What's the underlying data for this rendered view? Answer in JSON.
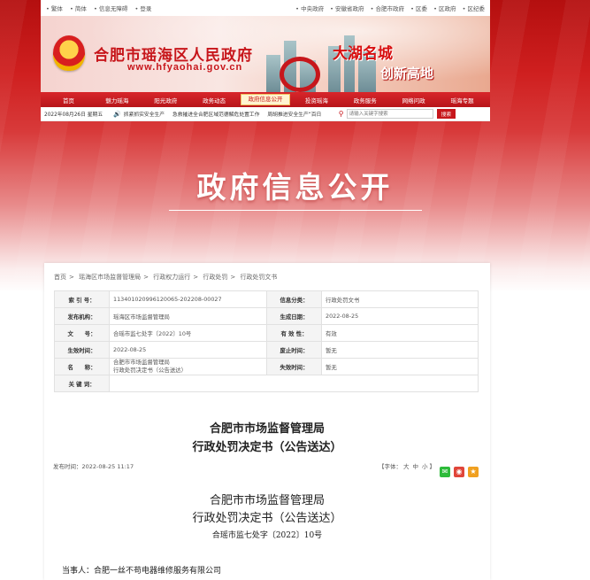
{
  "topbar": {
    "left": [
      "• 繁体",
      "• 简体",
      "• 信息无障碍",
      "• 登录"
    ],
    "right": [
      "• 中央政府",
      "• 安徽省政府",
      "• 合肥市政府",
      "• 区委",
      "• 区政府",
      "• 区纪委"
    ]
  },
  "banner": {
    "title": "合肥市瑶海区人民政府",
    "url": "www.hfyaohai.gov.cn",
    "slogan1": "大湖名城",
    "slogan2": "创新高地"
  },
  "nav": {
    "items": [
      "首页",
      "魅力瑶海",
      "阳光政府",
      "政务动态",
      "政府信息公开",
      "投资瑶海",
      "政务服务",
      "网络问政",
      "瑶海专题"
    ],
    "active_index": 4
  },
  "subbar": {
    "date": "2022年08月26日 星期五",
    "news": [
      "抓紧抓实安全生产",
      "急救摧进全合肥区域范德解危处置工作",
      "周胡推进安全生产“百日"
    ],
    "search_placeholder": "请输入关键字搜索",
    "search_button": "搜索"
  },
  "hero": {
    "title": "政府信息公开"
  },
  "breadcrumb": [
    "首页",
    "瑶海区市场监督管理局",
    "行政权力运行",
    "行政处罚",
    "行政处罚文书"
  ],
  "meta": {
    "index_label": "索 引 号：",
    "index_value": "113401020996120065-202208-00027",
    "category_label": "信息分类：",
    "category_value": "行政处罚文书",
    "publisher_label": "发布机构：",
    "publisher_value": "瑶海区市场监督管理局",
    "gen_date_label": "生成日期：",
    "gen_date_value": "2022-08-25",
    "docno_label": "文　　号：",
    "docno_value": "合瑶市监七处字〔2022〕10号",
    "validity_label": "有 效 性：",
    "validity_value": "有效",
    "effective_label": "生效时间：",
    "effective_value": "2022-08-25",
    "abolish_label": "废止时间：",
    "abolish_value": "暂无",
    "name_label": "名　　称：",
    "name_line1": "合肥市市场监督管理局",
    "name_line2": "行政处罚决定书（公告送达）",
    "expire_label": "失效时间：",
    "expire_value": "暂无",
    "keywords_label": "关 键 词：",
    "keywords_value": ""
  },
  "doc": {
    "title_line1": "合肥市市场监督管理局",
    "title_line2": "行政处罚决定书（公告送达）",
    "publish_time": "发布时间：2022-08-25 11:17",
    "font_label_open": "【字体：",
    "font_large": "大",
    "font_medium": "中",
    "font_small": "小",
    "font_label_close": "】",
    "body_line1": "合肥市市场监督管理局",
    "body_line2": "行政处罚决定书（公告送达）",
    "body_docno": "合瑶市监七处字〔2022〕10号",
    "party": "当事人：合肥一丝不苟电器维修服务有限公司"
  },
  "colors": {
    "brand_red": "#c7161b",
    "wechat": "#2dbb3a",
    "weibo": "#e0463a",
    "favorite": "#f0a020"
  }
}
